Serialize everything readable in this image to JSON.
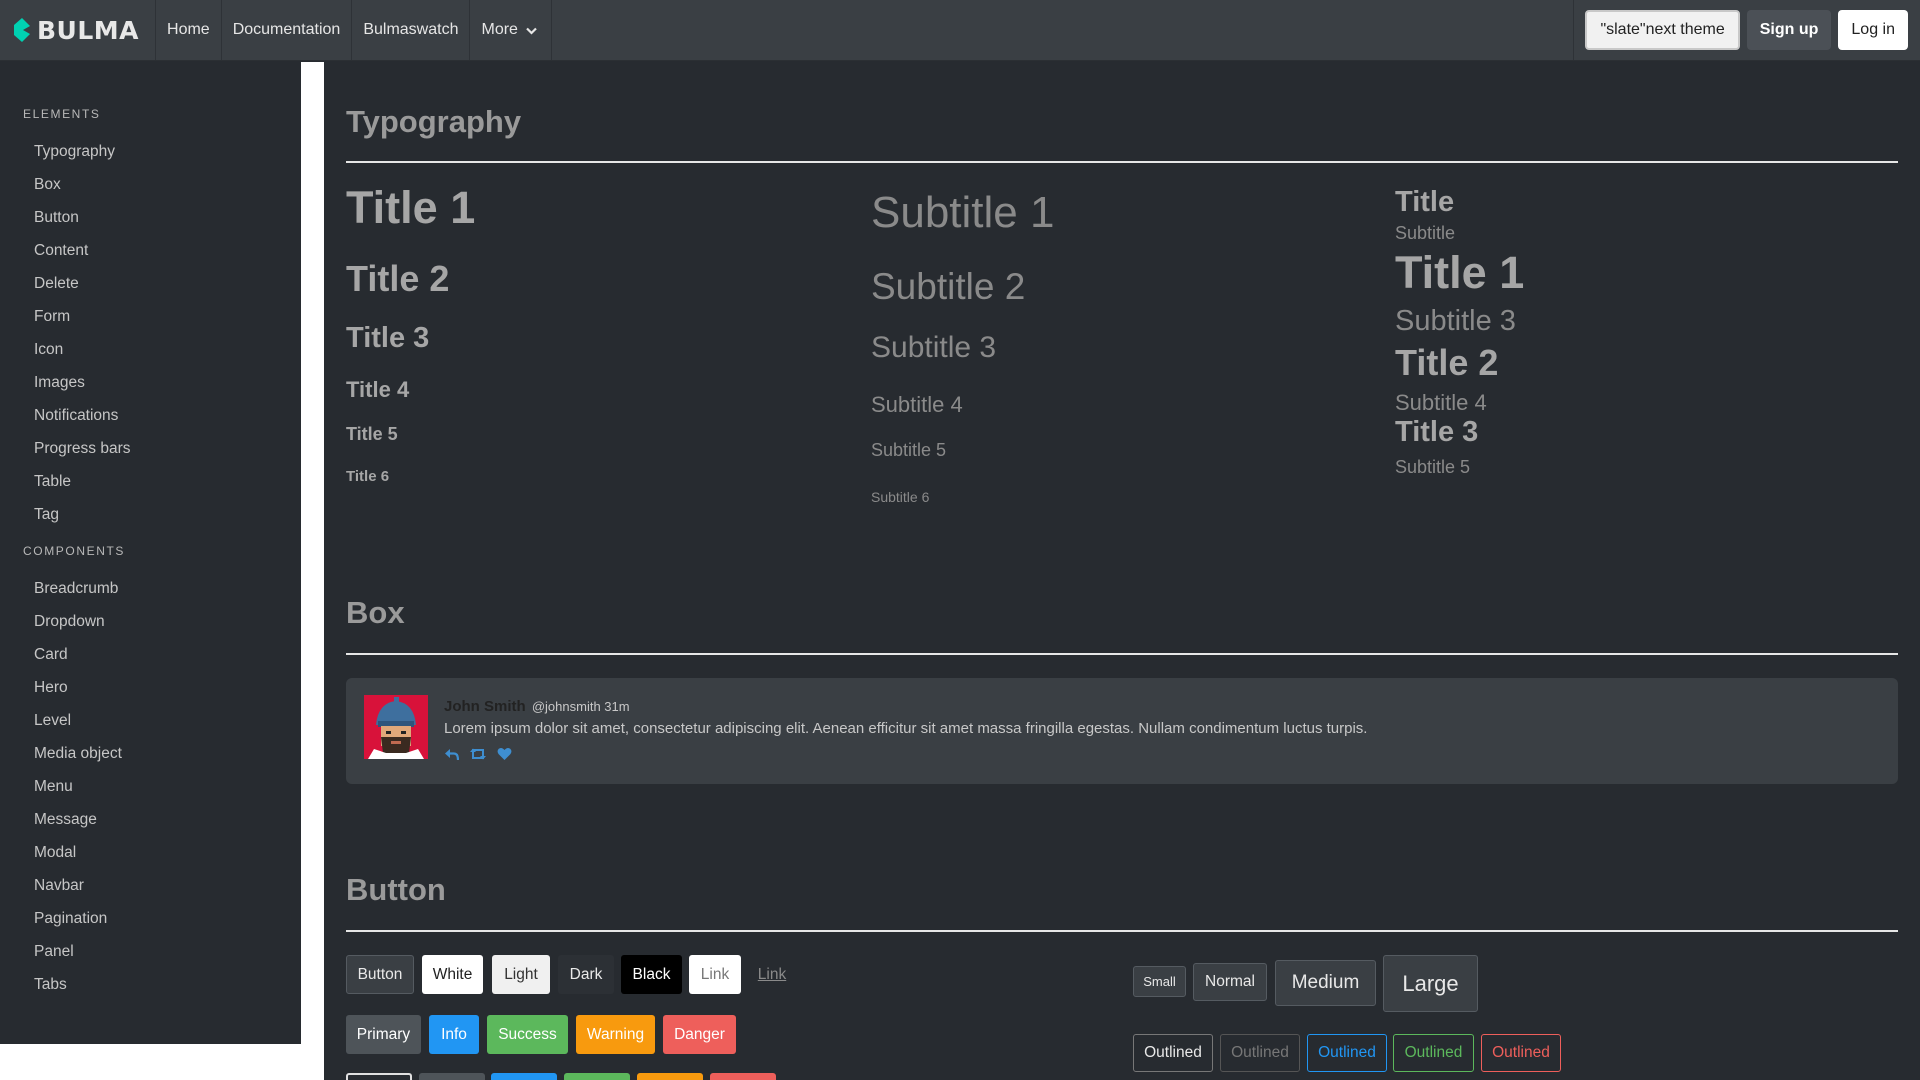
{
  "navbar": {
    "brand": "BULMA",
    "links": [
      "Home",
      "Documentation",
      "Bulmaswatch"
    ],
    "more": "More",
    "theme_button": "\"slate\"next theme",
    "signup": "Sign up",
    "login": "Log in"
  },
  "sidebar": {
    "elements_label": "ELEMENTS",
    "elements": [
      "Typography",
      "Box",
      "Button",
      "Content",
      "Delete",
      "Form",
      "Icon",
      "Images",
      "Notifications",
      "Progress bars",
      "Table",
      "Tag"
    ],
    "components_label": "COMPONENTS",
    "components": [
      "Breadcrumb",
      "Dropdown",
      "Card",
      "Hero",
      "Level",
      "Media object",
      "Menu",
      "Message",
      "Modal",
      "Navbar",
      "Pagination",
      "Panel",
      "Tabs"
    ]
  },
  "typography": {
    "heading": "Typography",
    "titles": [
      "Title 1",
      "Title 2",
      "Title 3",
      "Title 4",
      "Title 5",
      "Title 6"
    ],
    "subtitles": [
      "Subtitle 1",
      "Subtitle 2",
      "Subtitle 3",
      "Subtitle 4",
      "Subtitle 5",
      "Subtitle 6"
    ],
    "pairs": {
      "title": "Title",
      "subtitle": "Subtitle",
      "t1": "Title 1",
      "s3": "Subtitle 3",
      "t2": "Title 2",
      "s4": "Subtitle 4",
      "t3": "Title 3",
      "s5": "Subtitle 5"
    }
  },
  "box": {
    "heading": "Box",
    "name": "John Smith",
    "handle": "@johnsmith 31m",
    "text": "Lorem ipsum dolor sit amet, consectetur adipiscing elit. Aenean efficitur sit amet massa fringilla egestas. Nullam condimentum luctus turpis.",
    "icons": [
      "reply-icon",
      "retweet-icon",
      "heart-icon"
    ]
  },
  "button": {
    "heading": "Button",
    "row1": [
      "Button",
      "White",
      "Light",
      "Dark",
      "Black",
      "Link",
      "Link"
    ],
    "row2": [
      "Primary",
      "Info",
      "Success",
      "Warning",
      "Danger"
    ],
    "sizes": [
      "Small",
      "Normal",
      "Medium",
      "Large"
    ],
    "outlined": [
      "Outlined",
      "Outlined",
      "Outlined",
      "Outlined",
      "Outlined"
    ]
  },
  "colors": {
    "info": "#2196f3",
    "success": "#5cb85c",
    "warning": "#f89a0e",
    "danger": "#ee5f5b",
    "brand": "#00d1b2"
  }
}
